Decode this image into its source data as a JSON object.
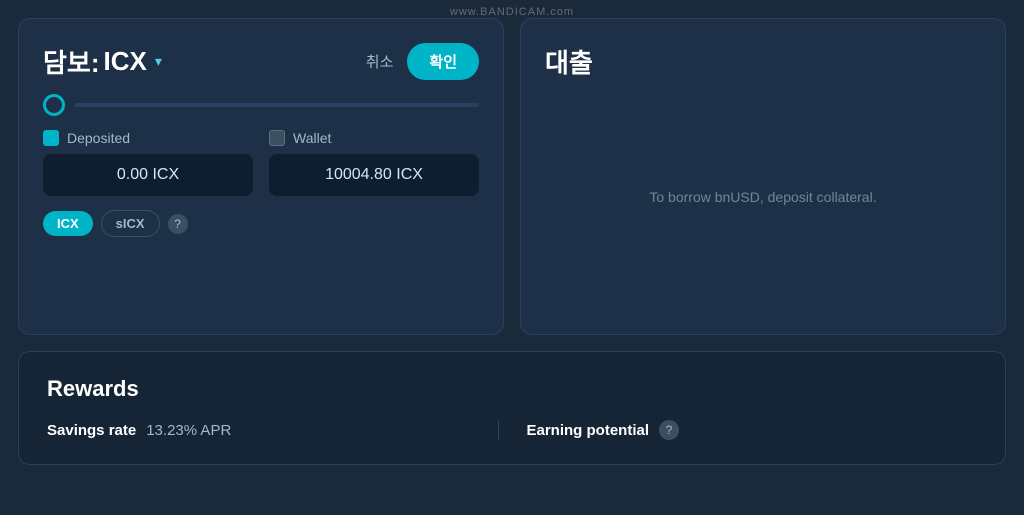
{
  "watermark": "www.BANDICAM.com",
  "collateral": {
    "title_prefix": "담보:",
    "asset": "ICX",
    "cancel_label": "취소",
    "confirm_label": "확인",
    "slider_value": 0,
    "deposited_label": "Deposited",
    "wallet_label": "Wallet",
    "deposited_amount": "0.00 ICX",
    "wallet_amount": "10004.80 ICX",
    "tab_icx": "ICX",
    "tab_sicx": "sICX",
    "help_icon": "?"
  },
  "loan": {
    "title": "대출",
    "message": "To borrow bnUSD, deposit collateral."
  },
  "rewards": {
    "title": "Rewards",
    "savings_rate_label": "Savings rate",
    "savings_rate_value": "13.23% APR",
    "earning_potential_label": "Earning potential",
    "help_icon": "?"
  }
}
